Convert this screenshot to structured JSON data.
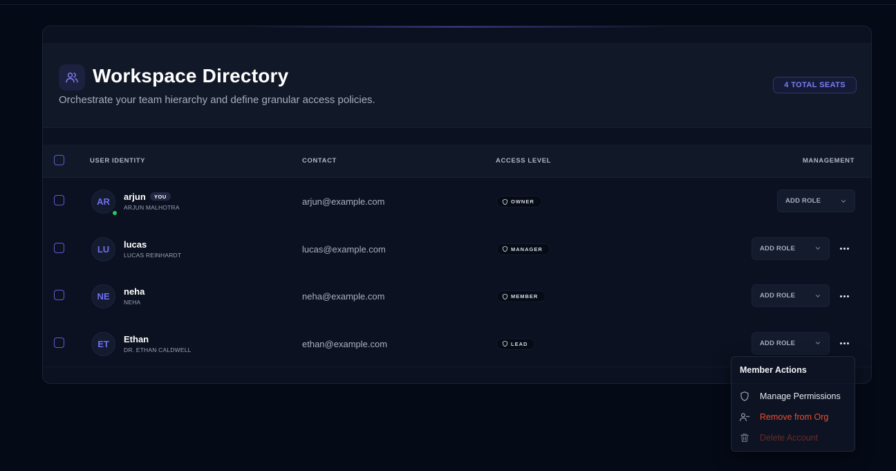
{
  "header": {
    "title": "Workspace Directory",
    "subtitle": "Orchestrate your team hierarchy and define granular access policies.",
    "seats_badge": "4 TOTAL SEATS",
    "icon": "users-icon"
  },
  "table": {
    "columns": {
      "identity": "USER IDENTITY",
      "contact": "CONTACT",
      "access": "ACCESS LEVEL",
      "management": "MANAGEMENT"
    },
    "add_role_label": "ADD ROLE",
    "rows": [
      {
        "initials": "AR",
        "username": "arjun",
        "you_label": "YOU",
        "fullname": "ARJUN MALHOTRA",
        "email": "arjun@example.com",
        "role": "OWNER",
        "online": true
      },
      {
        "initials": "LU",
        "username": "lucas",
        "fullname": "LUCAS REINHARDT",
        "email": "lucas@example.com",
        "role": "MANAGER"
      },
      {
        "initials": "NE",
        "username": "neha",
        "fullname": "NEHA",
        "email": "neha@example.com",
        "role": "MEMBER"
      },
      {
        "initials": "ET",
        "username": "Ethan",
        "fullname": "DR. ETHAN CALDWELL",
        "email": "ethan@example.com",
        "role": "LEAD"
      }
    ]
  },
  "menu": {
    "title": "Member Actions",
    "items": [
      {
        "label": "Manage Permissions",
        "icon": "shield-icon"
      },
      {
        "label": "Remove from Org",
        "icon": "user-minus-icon"
      },
      {
        "label": "Delete Account",
        "icon": "trash-icon"
      }
    ]
  },
  "colors": {
    "background": "#050a17",
    "accent": "#6e6ff0",
    "online": "#1fcf5a",
    "danger": "#f04d2f"
  }
}
